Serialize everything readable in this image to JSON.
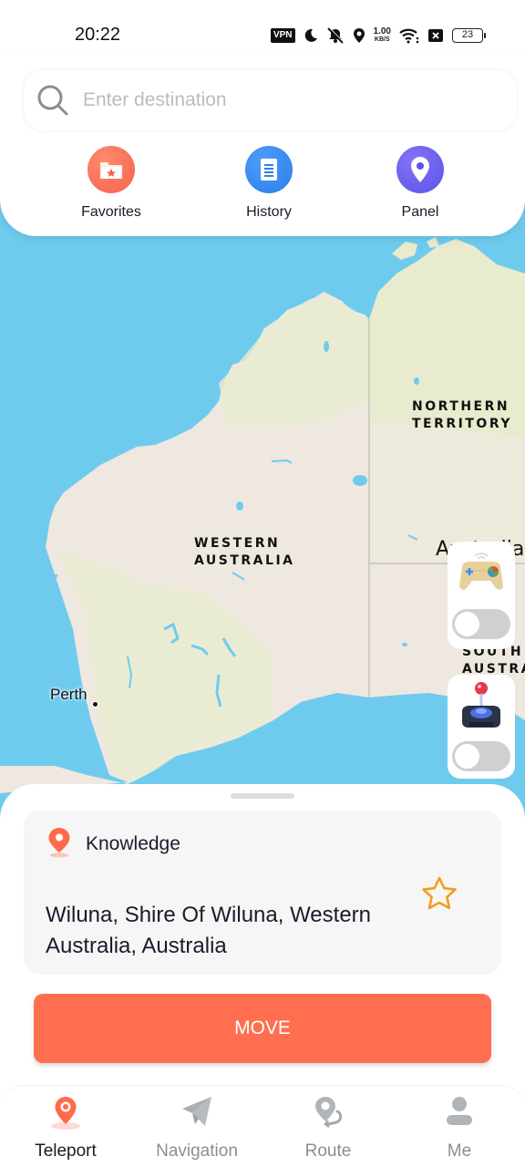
{
  "status_bar": {
    "time": "20:22",
    "vpn_label": "VPN",
    "network_speed": "1.00",
    "network_speed_unit": "KB/S",
    "battery_level": "23",
    "icons": [
      "vpn-icon",
      "moon-icon",
      "mute-icon",
      "location-icon",
      "wifi-icon",
      "sim-off-icon",
      "battery-icon"
    ]
  },
  "search": {
    "placeholder": "Enter destination",
    "value": ""
  },
  "quick_actions": [
    {
      "label": "Favorites",
      "icon": "folder-star-icon",
      "color": "#f7664b"
    },
    {
      "label": "History",
      "icon": "document-icon",
      "color": "#2f86f0"
    },
    {
      "label": "Panel",
      "icon": "location-pin-icon",
      "color": "#6a5bef"
    }
  ],
  "map": {
    "labels": {
      "northern_territory_line1": "NORTHERN",
      "northern_territory_line2": "TERRITORY",
      "western_australia_line1": "WESTERN",
      "western_australia_line2": "AUSTRALIA",
      "australia": "Australia",
      "south_australia_line1": "SOUTH",
      "south_australia_line2": "AUSTRALIA",
      "city_perth": "Perth"
    },
    "colors": {
      "water": "#6fcbee",
      "land_arid": "#eee8e0",
      "land_green": "#e9ebcf",
      "pin": "#ff6b4a"
    }
  },
  "floating_controls": [
    {
      "name": "gamepad",
      "icon": "gamepad-icon",
      "toggle_on": false
    },
    {
      "name": "joystick",
      "icon": "joystick-icon",
      "toggle_on": false
    }
  ],
  "location_card": {
    "title": "Knowledge",
    "address": "Wiluna, Shire Of Wiluna, Western Australia, Australia",
    "favorited": false
  },
  "move_button": {
    "label": "MOVE",
    "color": "#ff6f4f"
  },
  "tab_bar": {
    "active": "Teleport",
    "tabs": [
      {
        "label": "Teleport",
        "icon": "teleport-pin-icon"
      },
      {
        "label": "Navigation",
        "icon": "paper-plane-icon"
      },
      {
        "label": "Route",
        "icon": "route-icon"
      },
      {
        "label": "Me",
        "icon": "person-icon"
      }
    ]
  },
  "accent_color": "#ff6b4a"
}
